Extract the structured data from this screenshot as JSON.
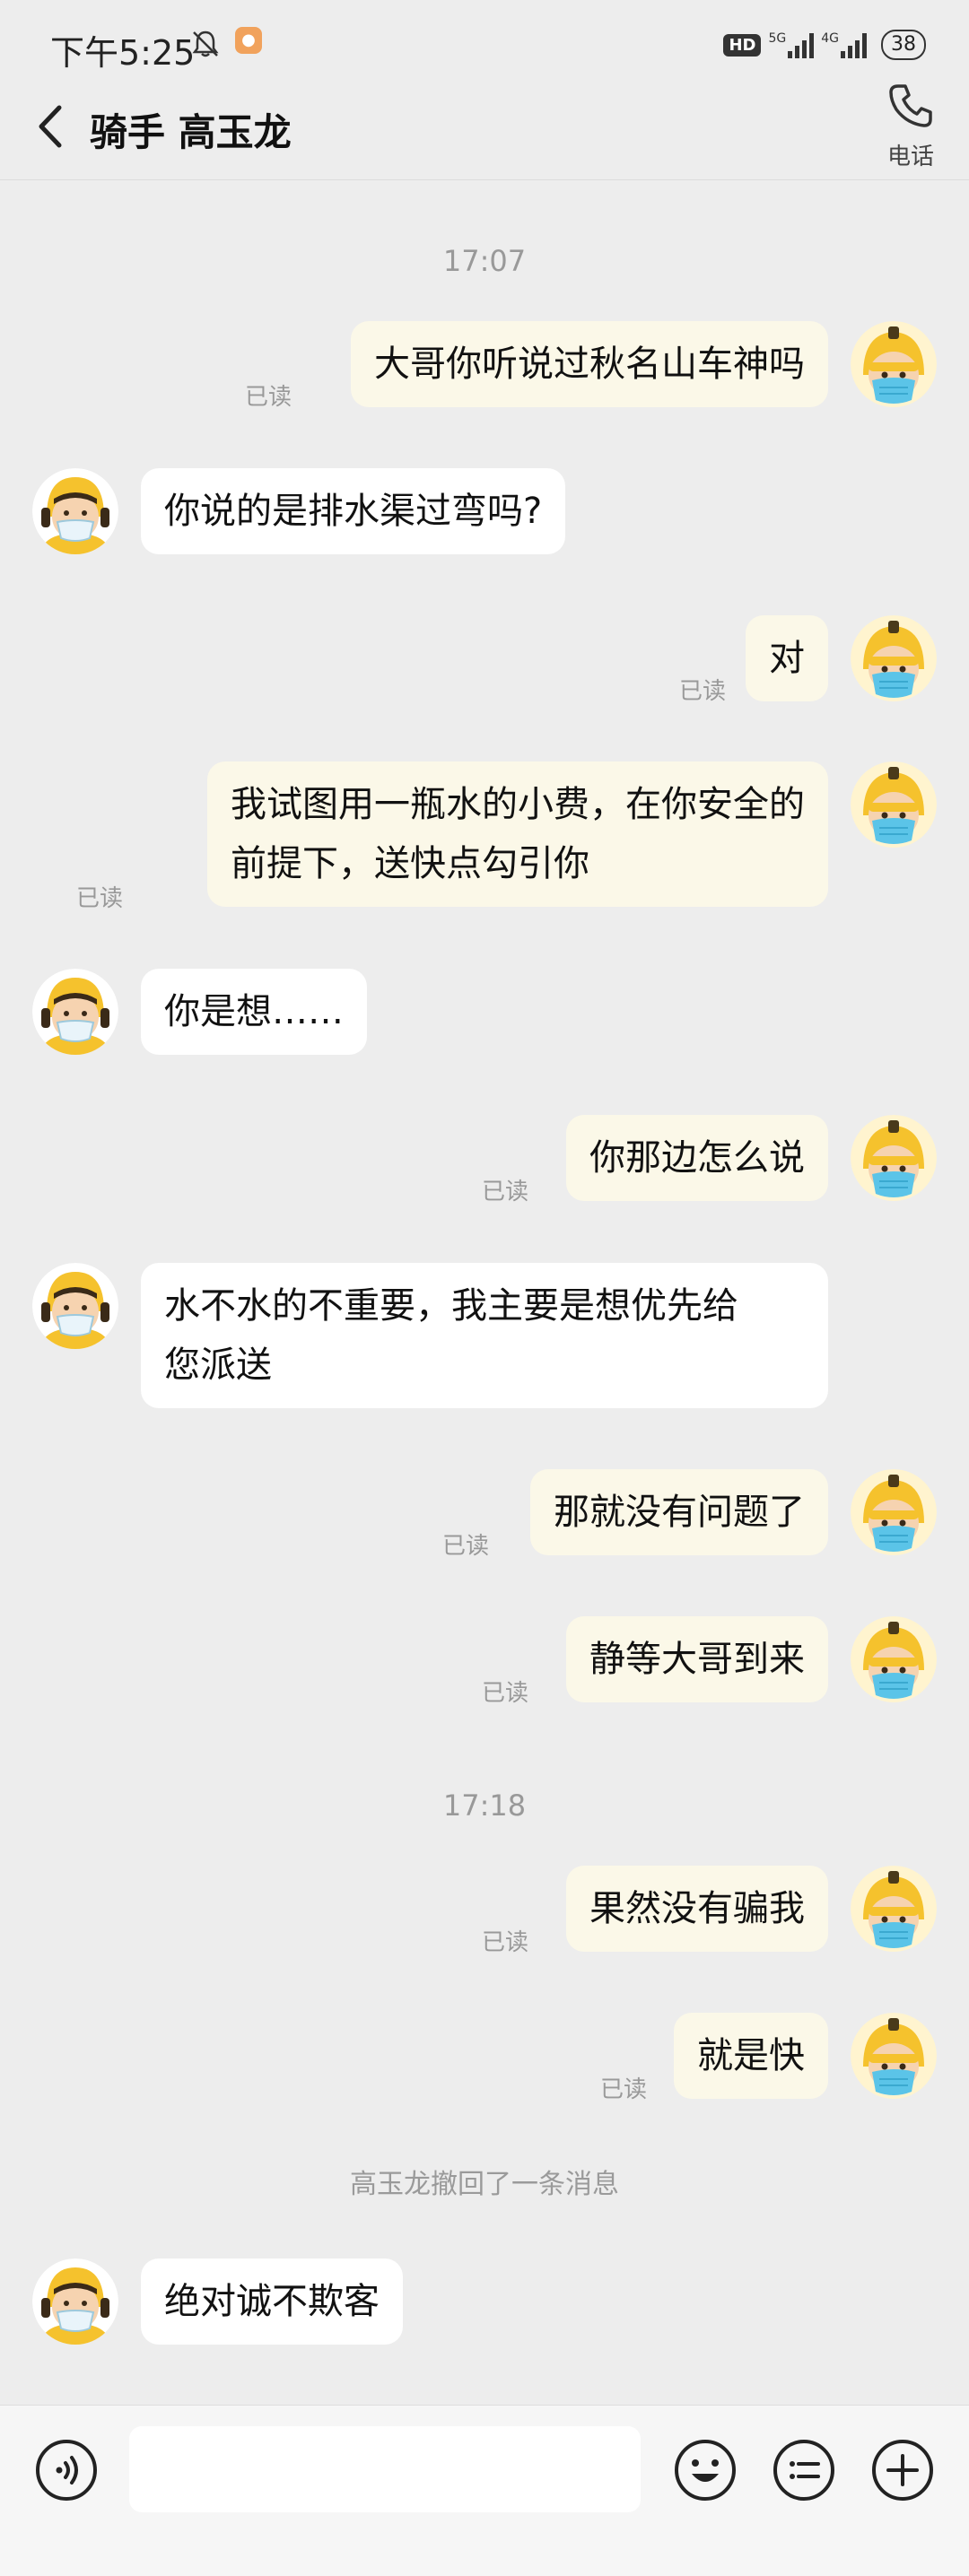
{
  "status_bar": {
    "time": "下午5:25",
    "hd": "HD",
    "net1": "5G",
    "net2": "4G",
    "battery": "38"
  },
  "header": {
    "title": "骑手 高玉龙",
    "call_label": "电话"
  },
  "timestamps": [
    "17:07",
    "17:18"
  ],
  "read_label": "已读",
  "messages": [
    {
      "side": "me",
      "text": "大哥你听说过秋名山车神吗",
      "read": true
    },
    {
      "side": "them",
      "text": "你说的是排水渠过弯吗?"
    },
    {
      "side": "me",
      "text": "对",
      "read": true
    },
    {
      "side": "me",
      "lines": [
        "我试图用一瓶水的小费，在你安全的",
        "前提下，送快点勾引你"
      ],
      "read": true
    },
    {
      "side": "them",
      "text": "你是想……"
    },
    {
      "side": "me",
      "text": "你那边怎么说",
      "read": true
    },
    {
      "side": "them",
      "lines": [
        "水不水的不重要，我主要是想优先给",
        "您派送"
      ]
    },
    {
      "side": "me",
      "text": "那就没有问题了",
      "read": true
    },
    {
      "side": "me",
      "text": "静等大哥到来",
      "read": true
    },
    {
      "side": "me",
      "text": "果然没有骗我",
      "read": true
    },
    {
      "side": "me",
      "text": "就是快",
      "read": true
    },
    {
      "side": "them",
      "text": "绝对诚不欺客"
    }
  ],
  "recall_notice": "高玉龙撤回了一条消息",
  "input": {
    "placeholder": ""
  },
  "icons": {
    "voice": "voice-icon",
    "emoji": "emoji-icon",
    "quick_reply": "quick-reply-icon",
    "plus": "plus-icon",
    "call": "phone-icon",
    "back": "back-icon"
  },
  "colors": {
    "bg": "#ededed",
    "my_bubble": "#fbf8e8",
    "their_bubble": "#ffffff",
    "rider_helmet": "#f5c22d",
    "mask": "#5bc4e8"
  }
}
